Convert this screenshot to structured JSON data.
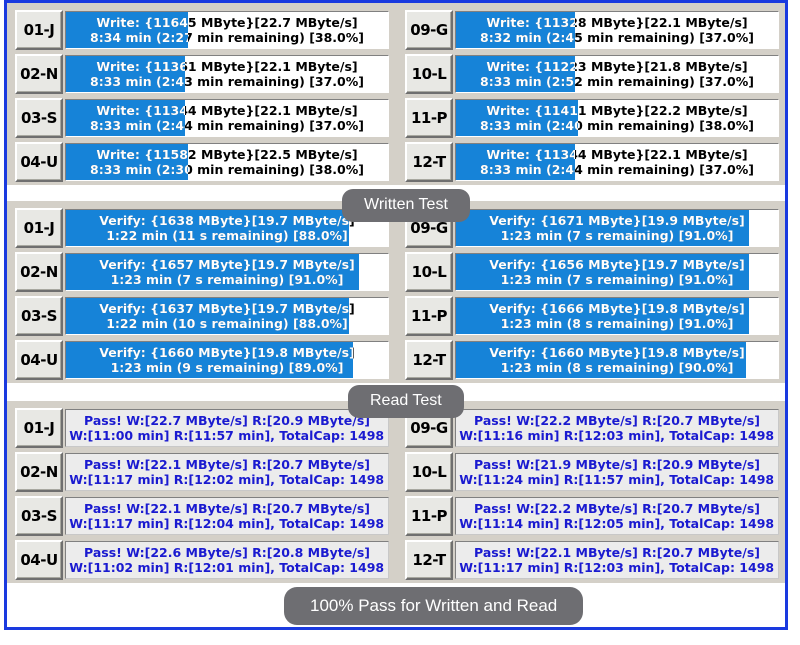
{
  "window": {
    "border_color": "#1a3adf",
    "panel_bg": "#d4d0c8",
    "bar_fill_color": "#1683d8",
    "pass_text_color": "#1a1ad0"
  },
  "badges": {
    "written": "Written Test",
    "read": "Read Test",
    "summary": "100% Pass for Written and Read"
  },
  "write_test": {
    "slots": [
      {
        "id": "01-J",
        "line1": "Write: {11645 MByte}[22.7 MByte/s]",
        "line2": "8:34 min (2:27 min remaining)   [38.0%]",
        "percent": 38.0,
        "written_mb": 11645,
        "speed": "22.7 MByte/s",
        "elapsed": "8:34 min",
        "remaining": "2:27 min"
      },
      {
        "id": "02-N",
        "line1": "Write: {11361 MByte}[22.1 MByte/s]",
        "line2": "8:33 min (2:43 min remaining)   [37.0%]",
        "percent": 37.0,
        "written_mb": 11361,
        "speed": "22.1 MByte/s",
        "elapsed": "8:33 min",
        "remaining": "2:43 min"
      },
      {
        "id": "03-S",
        "line1": "Write: {11344 MByte}[22.1 MByte/s]",
        "line2": "8:33 min (2:44 min remaining)   [37.0%]",
        "percent": 37.0,
        "written_mb": 11344,
        "speed": "22.1 MByte/s",
        "elapsed": "8:33 min",
        "remaining": "2:44 min"
      },
      {
        "id": "04-U",
        "line1": "Write: {11582 MByte}[22.5 MByte/s]",
        "line2": "8:33 min (2:30 min remaining)   [38.0%]",
        "percent": 38.0,
        "written_mb": 11582,
        "speed": "22.5 MByte/s",
        "elapsed": "8:33 min",
        "remaining": "2:30 min"
      },
      {
        "id": "09-G",
        "line1": "Write: {11328 MByte}[22.1 MByte/s]",
        "line2": "8:32 min (2:45 min remaining)   [37.0%]",
        "percent": 37.0,
        "written_mb": 11328,
        "speed": "22.1 MByte/s",
        "elapsed": "8:32 min",
        "remaining": "2:45 min"
      },
      {
        "id": "10-L",
        "line1": "Write: {11223 MByte}[21.8 MByte/s]",
        "line2": "8:33 min (2:52 min remaining)   [37.0%]",
        "percent": 37.0,
        "written_mb": 11223,
        "speed": "21.8 MByte/s",
        "elapsed": "8:33 min",
        "remaining": "2:52 min"
      },
      {
        "id": "11-P",
        "line1": "Write: {11411 MByte}[22.2 MByte/s]",
        "line2": "8:33 min (2:40 min remaining)   [38.0%]",
        "percent": 38.0,
        "written_mb": 11411,
        "speed": "22.2 MByte/s",
        "elapsed": "8:33 min",
        "remaining": "2:40 min"
      },
      {
        "id": "12-T",
        "line1": "Write: {11344 MByte}[22.1 MByte/s]",
        "line2": "8:33 min (2:44 min remaining)   [37.0%]",
        "percent": 37.0,
        "written_mb": 11344,
        "speed": "22.1 MByte/s",
        "elapsed": "8:33 min",
        "remaining": "2:44 min"
      }
    ]
  },
  "read_test": {
    "slots": [
      {
        "id": "01-J",
        "line1": "Verify: {1638 MByte}[19.7 MByte/s]",
        "line2": "1:22 min (11 s remaining)   [88.0%]",
        "percent": 88.0,
        "verified_mb": 1638,
        "speed": "19.7 MByte/s",
        "elapsed": "1:22 min",
        "remaining": "11 s"
      },
      {
        "id": "02-N",
        "line1": "Verify: {1657 MByte}[19.7 MByte/s]",
        "line2": "1:23 min (7 s remaining)   [91.0%]",
        "percent": 91.0,
        "verified_mb": 1657,
        "speed": "19.7 MByte/s",
        "elapsed": "1:23 min",
        "remaining": "7 s"
      },
      {
        "id": "03-S",
        "line1": "Verify: {1637 MByte}[19.7 MByte/s]",
        "line2": "1:22 min (10 s remaining)   [88.0%]",
        "percent": 88.0,
        "verified_mb": 1637,
        "speed": "19.7 MByte/s",
        "elapsed": "1:22 min",
        "remaining": "10 s"
      },
      {
        "id": "04-U",
        "line1": "Verify: {1660 MByte}[19.8 MByte/s]",
        "line2": "1:23 min (9 s remaining)   [89.0%]",
        "percent": 89.0,
        "verified_mb": 1660,
        "speed": "19.8 MByte/s",
        "elapsed": "1:23 min",
        "remaining": "9 s"
      },
      {
        "id": "09-G",
        "line1": "Verify: {1671 MByte}[19.9 MByte/s]",
        "line2": "1:23 min (7 s remaining)   [91.0%]",
        "percent": 91.0,
        "verified_mb": 1671,
        "speed": "19.9 MByte/s",
        "elapsed": "1:23 min",
        "remaining": "7 s"
      },
      {
        "id": "10-L",
        "line1": "Verify: {1656 MByte}[19.7 MByte/s]",
        "line2": "1:23 min (7 s remaining)   [91.0%]",
        "percent": 91.0,
        "verified_mb": 1656,
        "speed": "19.7 MByte/s",
        "elapsed": "1:23 min",
        "remaining": "7 s"
      },
      {
        "id": "11-P",
        "line1": "Verify: {1666 MByte}[19.8 MByte/s]",
        "line2": "1:23 min (8 s remaining)   [91.0%]",
        "percent": 91.0,
        "verified_mb": 1666,
        "speed": "19.8 MByte/s",
        "elapsed": "1:23 min",
        "remaining": "8 s"
      },
      {
        "id": "12-T",
        "line1": "Verify: {1660 MByte}[19.8 MByte/s]",
        "line2": "1:23 min (8 s remaining)   [90.0%]",
        "percent": 90.0,
        "verified_mb": 1660,
        "speed": "19.8 MByte/s",
        "elapsed": "1:23 min",
        "remaining": "8 s"
      }
    ]
  },
  "pass_results": {
    "slots": [
      {
        "id": "01-J",
        "line1": "Pass! W:[22.7 MByte/s] R:[20.9 MByte/s]",
        "line2": ": W:[11:00 min] R:[11:57 min], TotalCap: 1498",
        "write_speed": "22.7 MByte/s",
        "read_speed": "20.9 MByte/s",
        "write_time": "11:00 min",
        "read_time": "11:57 min",
        "total_cap": "1498"
      },
      {
        "id": "02-N",
        "line1": "Pass! W:[22.1 MByte/s] R:[20.7 MByte/s]",
        "line2": ": W:[11:17 min] R:[12:02 min], TotalCap: 1498",
        "write_speed": "22.1 MByte/s",
        "read_speed": "20.7 MByte/s",
        "write_time": "11:17 min",
        "read_time": "12:02 min",
        "total_cap": "1498"
      },
      {
        "id": "03-S",
        "line1": "Pass! W:[22.1 MByte/s] R:[20.7 MByte/s]",
        "line2": ": W:[11:17 min] R:[12:04 min], TotalCap: 1498",
        "write_speed": "22.1 MByte/s",
        "read_speed": "20.7 MByte/s",
        "write_time": "11:17 min",
        "read_time": "12:04 min",
        "total_cap": "1498"
      },
      {
        "id": "04-U",
        "line1": "Pass! W:[22.6 MByte/s] R:[20.8 MByte/s]",
        "line2": ": W:[11:02 min] R:[12:01 min], TotalCap: 1498",
        "write_speed": "22.6 MByte/s",
        "read_speed": "20.8 MByte/s",
        "write_time": "11:02 min",
        "read_time": "12:01 min",
        "total_cap": "1498"
      },
      {
        "id": "09-G",
        "line1": "Pass! W:[22.2 MByte/s] R:[20.7 MByte/s]",
        "line2": ": W:[11:16 min] R:[12:03 min], TotalCap: 1498",
        "write_speed": "22.2 MByte/s",
        "read_speed": "20.7 MByte/s",
        "write_time": "11:16 min",
        "read_time": "12:03 min",
        "total_cap": "1498"
      },
      {
        "id": "10-L",
        "line1": "Pass! W:[21.9 MByte/s] R:[20.9 MByte/s]",
        "line2": ": W:[11:24 min] R:[11:57 min], TotalCap: 1498",
        "write_speed": "21.9 MByte/s",
        "read_speed": "20.9 MByte/s",
        "write_time": "11:24 min",
        "read_time": "11:57 min",
        "total_cap": "1498"
      },
      {
        "id": "11-P",
        "line1": "Pass! W:[22.2 MByte/s] R:[20.7 MByte/s]",
        "line2": ": W:[11:14 min] R:[12:05 min], TotalCap: 1498",
        "write_speed": "22.2 MByte/s",
        "read_speed": "20.7 MByte/s",
        "write_time": "11:14 min",
        "read_time": "12:05 min",
        "total_cap": "1498"
      },
      {
        "id": "12-T",
        "line1": "Pass! W:[22.1 MByte/s] R:[20.7 MByte/s]",
        "line2": ": W:[11:17 min] R:[12:03 min], TotalCap: 1498",
        "write_speed": "22.1 MByte/s",
        "read_speed": "20.7 MByte/s",
        "write_time": "11:17 min",
        "read_time": "12:03 min",
        "total_cap": "1498"
      }
    ]
  }
}
